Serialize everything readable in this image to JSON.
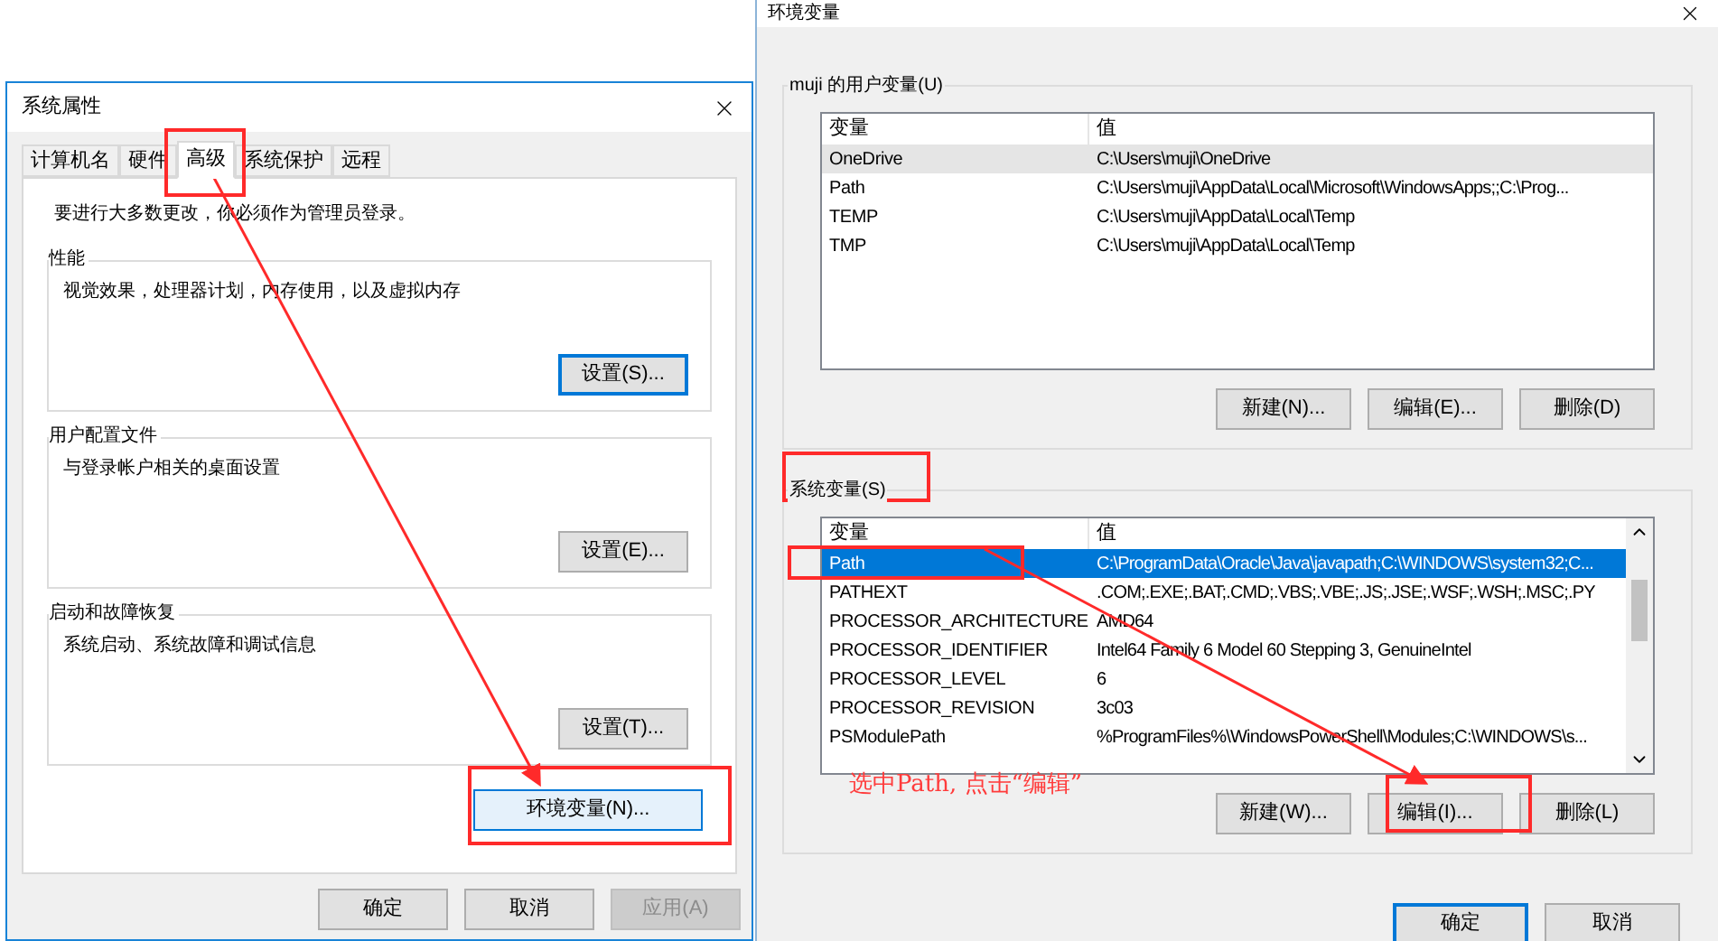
{
  "system_properties": {
    "title": "系统属性",
    "tabs": [
      {
        "label": "计算机名",
        "selected": false
      },
      {
        "label": "硬件",
        "selected": false
      },
      {
        "label": "高级",
        "selected": true
      },
      {
        "label": "系统保护",
        "selected": false
      },
      {
        "label": "远程",
        "selected": false
      }
    ],
    "notice": "要进行大多数更改，你必须作为管理员登录。",
    "groups": [
      {
        "title": "性能",
        "description": "视觉效果，处理器计划，内存使用，以及虚拟内存",
        "button": {
          "label": "设置(S)...",
          "default": true
        }
      },
      {
        "title": "用户配置文件",
        "description": "与登录帐户相关的桌面设置",
        "button": {
          "label": "设置(E)...",
          "default": false
        }
      },
      {
        "title": "启动和故障恢复",
        "description": "系统启动、系统故障和调试信息",
        "button": {
          "label": "设置(T)...",
          "default": false
        }
      }
    ],
    "env_button": {
      "label": "环境变量(N)...",
      "hovered": true
    },
    "buttons": [
      {
        "label": "确定",
        "disabled": false
      },
      {
        "label": "取消",
        "disabled": false
      },
      {
        "label": "应用(A)",
        "disabled": true
      }
    ]
  },
  "environment_variables": {
    "title": "环境变量",
    "user_group": {
      "title": "muji 的用户变量(U)",
      "columns": [
        "变量",
        "值"
      ],
      "rows": [
        {
          "name": "OneDrive",
          "value": "C:\\Users\\muji\\OneDrive",
          "selected": false,
          "hovered": true
        },
        {
          "name": "Path",
          "value": "C:\\Users\\muji\\AppData\\Local\\Microsoft\\WindowsApps;;C:\\Prog...",
          "selected": false,
          "hovered": false
        },
        {
          "name": "TEMP",
          "value": "C:\\Users\\muji\\AppData\\Local\\Temp",
          "selected": false,
          "hovered": false
        },
        {
          "name": "TMP",
          "value": "C:\\Users\\muji\\AppData\\Local\\Temp",
          "selected": false,
          "hovered": false
        }
      ],
      "buttons": [
        {
          "label": "新建(N)..."
        },
        {
          "label": "编辑(E)..."
        },
        {
          "label": "删除(D)"
        }
      ]
    },
    "system_group": {
      "title": "系统变量(S)",
      "columns": [
        "变量",
        "值"
      ],
      "rows": [
        {
          "name": "Path",
          "value": "C:\\ProgramData\\Oracle\\Java\\javapath;C:\\WINDOWS\\system32;C...",
          "selected": true,
          "hovered": false
        },
        {
          "name": "PATHEXT",
          "value": ".COM;.EXE;.BAT;.CMD;.VBS;.VBE;.JS;.JSE;.WSF;.WSH;.MSC;.PY",
          "selected": false,
          "hovered": false
        },
        {
          "name": "PROCESSOR_ARCHITECTURE",
          "value": "AMD64",
          "selected": false,
          "hovered": false
        },
        {
          "name": "PROCESSOR_IDENTIFIER",
          "value": "Intel64 Family 6 Model 60 Stepping 3, GenuineIntel",
          "selected": false,
          "hovered": false
        },
        {
          "name": "PROCESSOR_LEVEL",
          "value": "6",
          "selected": false,
          "hovered": false
        },
        {
          "name": "PROCESSOR_REVISION",
          "value": "3c03",
          "selected": false,
          "hovered": false
        },
        {
          "name": "PSModulePath",
          "value": "%ProgramFiles%\\WindowsPowerShell\\Modules;C:\\WINDOWS\\s...",
          "selected": false,
          "hovered": false
        }
      ],
      "buttons": [
        {
          "label": "新建(W)..."
        },
        {
          "label": "编辑(I)..."
        },
        {
          "label": "删除(L)"
        }
      ]
    },
    "buttons": [
      {
        "label": "确定",
        "default": true
      },
      {
        "label": "取消",
        "default": false
      }
    ]
  },
  "annotation": {
    "text": "选中Path, 点击“编辑”"
  }
}
